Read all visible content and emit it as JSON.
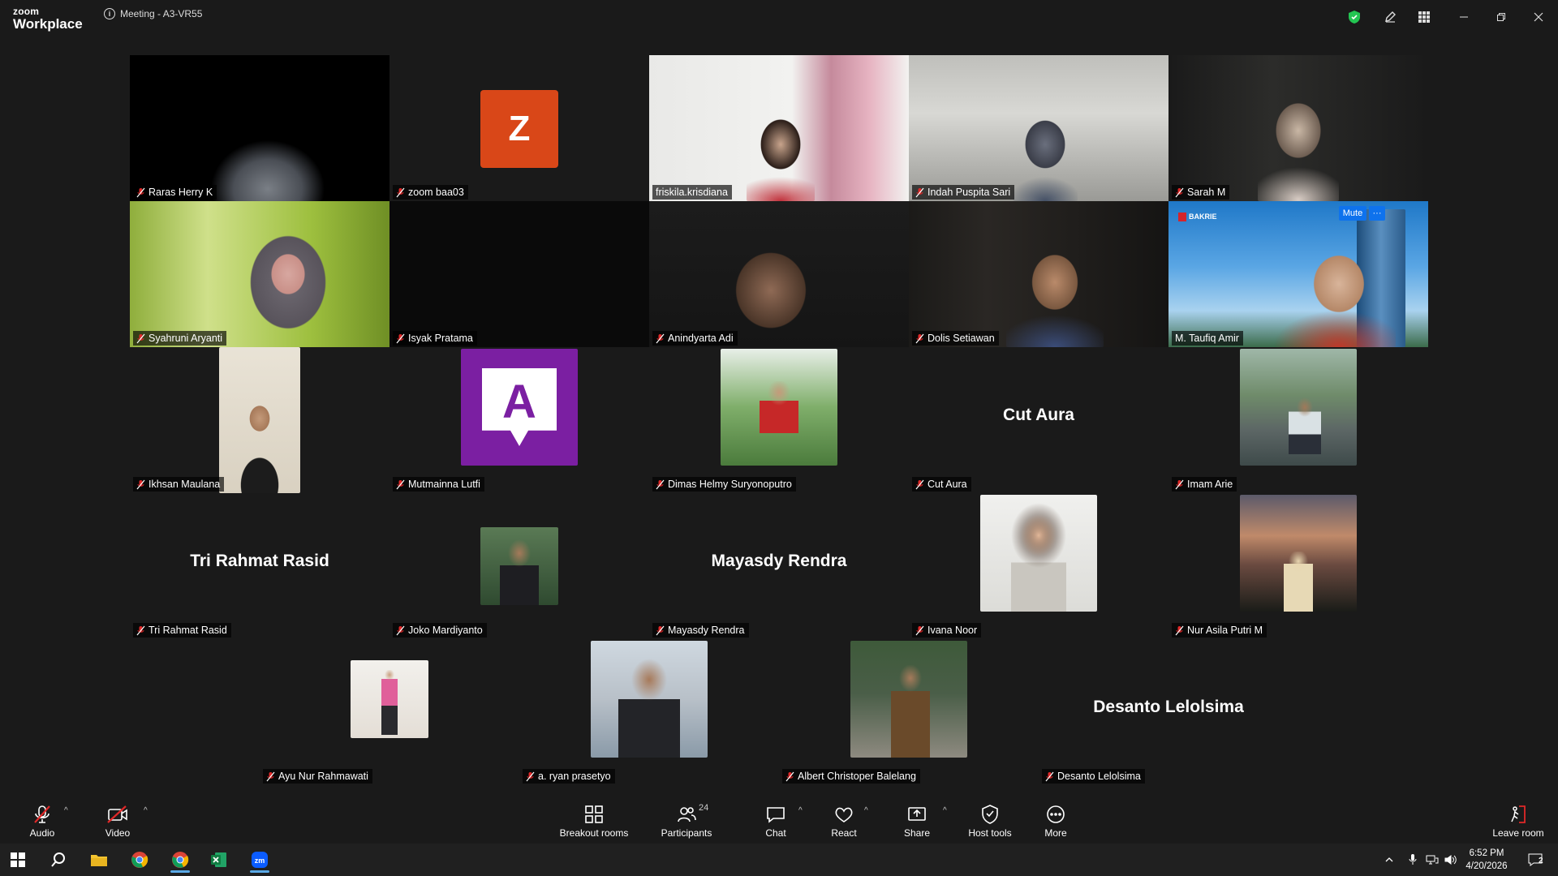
{
  "app": {
    "logo_line1": "zoom",
    "logo_line2": "Workplace",
    "meeting_title": "Meeting - A3-VR55"
  },
  "colors": {
    "accent": "#0e72ed",
    "active_speaker": "#23d5a0",
    "mic_muted": "#e02828",
    "shield": "#23c552"
  },
  "participants": [
    {
      "name": "Raras Herry K"
    },
    {
      "name": "zoom baa03",
      "initial": "Z"
    },
    {
      "name": "friskila.krisdiana"
    },
    {
      "name": "Indah Puspita Sari"
    },
    {
      "name": "Sarah M"
    },
    {
      "name": "Syahruni Aryanti"
    },
    {
      "name": "Isyak Pratama"
    },
    {
      "name": "Anindyarta Adi"
    },
    {
      "name": "Dolis Setiawan"
    },
    {
      "name": "M. Taufiq Amir",
      "mute_label": "Mute",
      "more_label": "···",
      "logo_text": "BAKRIE"
    },
    {
      "name": "Ikhsan Maulana"
    },
    {
      "name": "Mutmainna Lutfi",
      "initial": "A"
    },
    {
      "name": "Dimas Helmy Suryonoputro"
    },
    {
      "name": "Cut Aura"
    },
    {
      "name": "Imam Arie"
    },
    {
      "name": "Tri Rahmat Rasid"
    },
    {
      "name": "Joko Mardiyanto"
    },
    {
      "name": "Mayasdy Rendra"
    },
    {
      "name": "Ivana Noor"
    },
    {
      "name": "Nur Asila Putri M"
    },
    {
      "name": "Ayu Nur Rahmawati"
    },
    {
      "name": "a. ryan prasetyo"
    },
    {
      "name": "Albert Christoper Balelang"
    },
    {
      "name": "Desanto Lelolsima"
    }
  ],
  "toolbar": {
    "audio": "Audio",
    "video": "Video",
    "breakout": "Breakout rooms",
    "participants": "Participants",
    "participants_count": "24",
    "chat": "Chat",
    "react": "React",
    "share": "Share",
    "host_tools": "Host tools",
    "more": "More",
    "leave": "Leave room"
  },
  "taskbar": {
    "time": "6:52 PM",
    "date": "4/20/2026",
    "notifications": "2"
  }
}
